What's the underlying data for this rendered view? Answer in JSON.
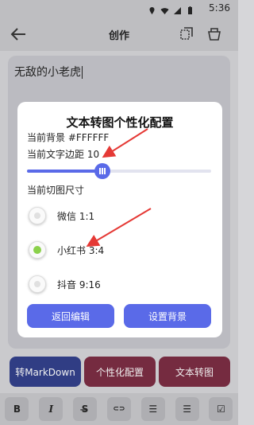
{
  "status": {
    "time": "5:36",
    "icons": [
      "location-icon",
      "wifi-icon",
      "signal-icon",
      "battery-icon"
    ]
  },
  "appbar": {
    "title": "创作",
    "back_icon": "back-arrow-icon",
    "actions": [
      "copy-icon",
      "clear-icon"
    ]
  },
  "editor": {
    "text": "无敌的小老虎"
  },
  "bottom_buttons": [
    "转MarkDown",
    "个性化配置",
    "文本转图"
  ],
  "toolbar": [
    {
      "icon": "bold-icon",
      "glyph": "B"
    },
    {
      "icon": "italic-icon",
      "glyph": "I"
    },
    {
      "icon": "strikethrough-icon",
      "glyph": "S̶"
    },
    {
      "icon": "link-icon",
      "glyph": "⊂⊃"
    },
    {
      "icon": "bullet-list-icon",
      "glyph": "☰"
    },
    {
      "icon": "numbered-list-icon",
      "glyph": "☰"
    },
    {
      "icon": "checkbox-icon",
      "glyph": "☑"
    }
  ],
  "dialog": {
    "title": "文本转图个性化配置",
    "background_line": "当前背景 #FFFFFF",
    "margin_line": "当前文字边距 10",
    "margin_slider_fraction": 0.41,
    "size_label": "当前切图尺寸",
    "options": [
      {
        "label": "微信 1:1",
        "selected": false
      },
      {
        "label": "小红书 3:4",
        "selected": true
      },
      {
        "label": "抖音 9:16",
        "selected": false
      }
    ],
    "back_button": "返回编辑",
    "set_bg_button": "设置背景"
  },
  "colors": {
    "accent": "#5a6ae8",
    "selected_radio": "#8bd14b",
    "arrow": "#e53935"
  }
}
